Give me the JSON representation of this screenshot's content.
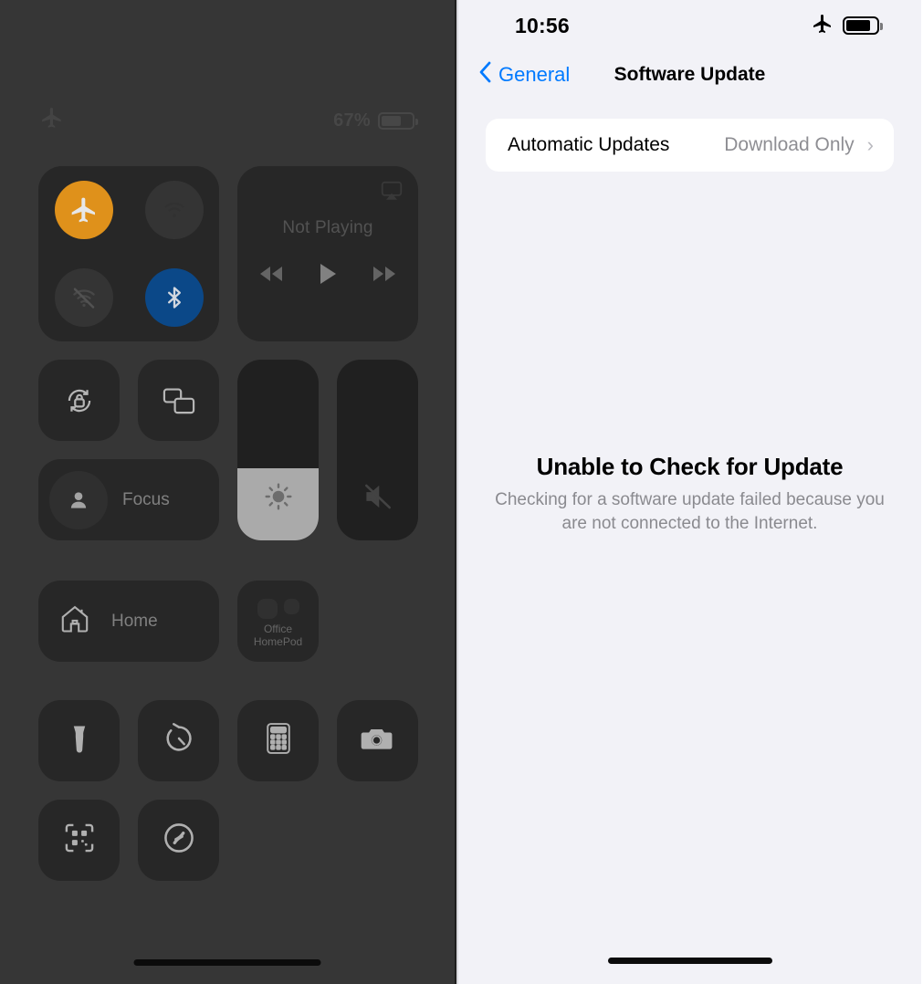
{
  "control_center": {
    "status_bar": {
      "airplane_icon": "airplane-icon",
      "battery_percent": "67%",
      "battery_icon": "battery-icon",
      "battery_level": 67
    },
    "connectivity": {
      "airplane": {
        "name": "Airplane Mode",
        "state": "on",
        "color": "#f7a01c"
      },
      "cellular": {
        "name": "Cellular Data",
        "state": "off"
      },
      "wifi": {
        "name": "Wi-Fi",
        "state": "off"
      },
      "bluetooth": {
        "name": "Bluetooth",
        "state": "on",
        "color": "#0b4f96"
      }
    },
    "media": {
      "title": "Not Playing",
      "airplay_icon": "airplay-icon",
      "rewind_icon": "rewind-icon",
      "play_icon": "play-icon",
      "forward_icon": "fast-forward-icon"
    },
    "toggles": {
      "rotation_lock": "rotation-lock-icon",
      "screen_mirroring": "screen-mirroring-icon"
    },
    "focus": {
      "label": "Focus",
      "icon": "person-icon"
    },
    "brightness": {
      "icon": "brightness-icon",
      "level": 40
    },
    "volume": {
      "icon": "volume-mute-icon",
      "level": 0,
      "muted": true
    },
    "home": {
      "label": "Home",
      "icon": "home-icon"
    },
    "homepod": {
      "label_line1": "Office",
      "label_line2": "HomePod",
      "icon": "homepod-icon"
    },
    "shortcuts": [
      {
        "name": "flashlight-icon",
        "label": "Flashlight"
      },
      {
        "name": "timer-icon",
        "label": "Timer"
      },
      {
        "name": "calculator-icon",
        "label": "Calculator"
      },
      {
        "name": "camera-icon",
        "label": "Camera"
      },
      {
        "name": "qr-code-scanner-icon",
        "label": "Code Scanner"
      },
      {
        "name": "shazam-icon",
        "label": "Music Recognition"
      }
    ],
    "home_indicator": "home-indicator"
  },
  "software_update": {
    "status_bar": {
      "time": "10:56",
      "airplane_icon": "airplane-icon",
      "battery_icon": "battery-icon"
    },
    "nav": {
      "back_label": "General",
      "back_icon": "chevron-left-icon",
      "title": "Software Update"
    },
    "automatic_updates": {
      "label": "Automatic Updates",
      "value": "Download Only",
      "chevron": "›"
    },
    "error": {
      "title": "Unable to Check for Update",
      "body": "Checking for a software update failed because you are not connected to the Internet."
    },
    "home_indicator": "home-indicator"
  },
  "colors": {
    "accent_blue": "#007aff",
    "airplane_orange": "#f7a01c",
    "bluetooth_blue": "#0b4f96",
    "settings_bg": "#f2f2f7",
    "cc_bg": "#3a3a3a"
  }
}
